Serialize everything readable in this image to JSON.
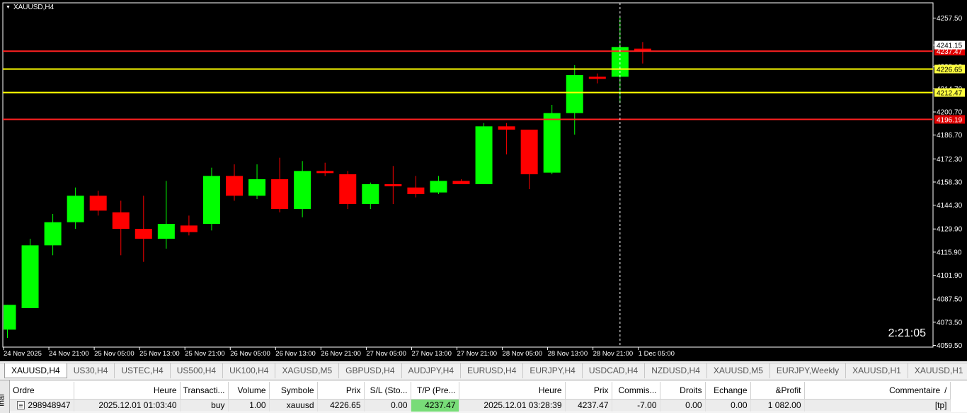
{
  "chart": {
    "symbol_label": "XAUUSD,H4",
    "timer": "2:21:05",
    "crosshair_time": "28 Nov 21:00",
    "x_labels": [
      "24 Nov 2025",
      "24 Nov 21:00",
      "25 Nov 05:00",
      "25 Nov 13:00",
      "25 Nov 21:00",
      "26 Nov 05:00",
      "26 Nov 13:00",
      "26 Nov 21:00",
      "27 Nov 05:00",
      "27 Nov 13:00",
      "27 Nov 21:00",
      "28 Nov 05:00",
      "28 Nov 13:00",
      "28 Nov 21:00",
      "1 Dec 05:00"
    ],
    "y_ticks": [
      "4257.50",
      "4241.15",
      "4228.10",
      "4214.70",
      "4200.70",
      "4186.70",
      "4172.30",
      "4158.30",
      "4144.30",
      "4129.90",
      "4115.90",
      "4101.90",
      "4087.50",
      "4073.50",
      "4059.50"
    ],
    "price_tags": [
      {
        "text": "4237.47",
        "color": "#e00000",
        "text_color": "#ffffff"
      },
      {
        "text": "4226.65",
        "color": "#ffff40",
        "text_color": "#000000"
      },
      {
        "text": "4212.47",
        "color": "#ffff40",
        "text_color": "#000000"
      },
      {
        "text": "4196.19",
        "color": "#e00000",
        "text_color": "#ffffff"
      },
      {
        "text": "4241.15",
        "color": "#ffffff",
        "text_color": "#000000"
      }
    ],
    "colors": {
      "background": "#000000",
      "bull": "#00ff00",
      "bear": "#ff0000",
      "axis_text": "#ffffff",
      "sl_line": "#ff2020",
      "entry_line": "#ffff00"
    }
  },
  "chart_data": {
    "type": "candlestick",
    "symbol": "XAUUSD",
    "timeframe": "H4",
    "ylim": [
      4059.5,
      4264
    ],
    "horizontal_lines": [
      4237.47,
      4226.65,
      4212.47,
      4196.19
    ],
    "candles": [
      {
        "o": 4069,
        "h": 4084,
        "l": 4064,
        "c": 4084
      },
      {
        "o": 4082,
        "h": 4124,
        "l": 4082,
        "c": 4120
      },
      {
        "o": 4120,
        "h": 4139,
        "l": 4114,
        "c": 4134
      },
      {
        "o": 4134,
        "h": 4155,
        "l": 4130,
        "c": 4150
      },
      {
        "o": 4150,
        "h": 4153,
        "l": 4138,
        "c": 4141
      },
      {
        "o": 4140,
        "h": 4147,
        "l": 4114,
        "c": 4130
      },
      {
        "o": 4130,
        "h": 4150,
        "l": 4110,
        "c": 4124
      },
      {
        "o": 4124,
        "h": 4159,
        "l": 4118,
        "c": 4133
      },
      {
        "o": 4132,
        "h": 4138,
        "l": 4126,
        "c": 4128
      },
      {
        "o": 4133,
        "h": 4167,
        "l": 4129,
        "c": 4162
      },
      {
        "o": 4162,
        "h": 4169,
        "l": 4147,
        "c": 4150
      },
      {
        "o": 4150,
        "h": 4169,
        "l": 4148,
        "c": 4160
      },
      {
        "o": 4160,
        "h": 4173,
        "l": 4140,
        "c": 4142
      },
      {
        "o": 4142,
        "h": 4171,
        "l": 4137,
        "c": 4165
      },
      {
        "o": 4165,
        "h": 4170,
        "l": 4162,
        "c": 4164
      },
      {
        "o": 4163,
        "h": 4165,
        "l": 4142,
        "c": 4145
      },
      {
        "o": 4145,
        "h": 4158,
        "l": 4142,
        "c": 4157
      },
      {
        "o": 4157,
        "h": 4168,
        "l": 4145,
        "c": 4156
      },
      {
        "o": 4155,
        "h": 4162,
        "l": 4149,
        "c": 4151
      },
      {
        "o": 4152,
        "h": 4162,
        "l": 4151,
        "c": 4159
      },
      {
        "o": 4159,
        "h": 4160,
        "l": 4157,
        "c": 4157
      },
      {
        "o": 4157,
        "h": 4194,
        "l": 4157,
        "c": 4192
      },
      {
        "o": 4192,
        "h": 4194,
        "l": 4175,
        "c": 4190
      },
      {
        "o": 4190,
        "h": 4190,
        "l": 4154,
        "c": 4163
      },
      {
        "o": 4164,
        "h": 4205,
        "l": 4163,
        "c": 4200
      },
      {
        "o": 4200,
        "h": 4229,
        "l": 4187,
        "c": 4223
      },
      {
        "o": 4222,
        "h": 4224,
        "l": 4218,
        "c": 4221
      },
      {
        "o": 4222,
        "h": 4258,
        "l": 4206,
        "c": 4240
      },
      {
        "o": 4239,
        "h": 4243,
        "l": 4230,
        "c": 4238
      }
    ]
  },
  "tabs": [
    "XAUUSD,H4",
    "US30,H4",
    "USTEC,H4",
    "US500,H4",
    "UK100,H4",
    "XAGUSD,M5",
    "GBPUSD,H4",
    "AUDJPY,H4",
    "EURUSD,H4",
    "EURJPY,H4",
    "USDCAD,H4",
    "NZDUSD,H4",
    "XAUUSD,M5",
    "EURJPY,Weekly",
    "XAUUSD,H1",
    "XAUUSD,H1"
  ],
  "terminal": {
    "side_label": "inal",
    "headers": [
      "Ordre",
      "Heure",
      "Transacti...",
      "Volume",
      "Symbole",
      "Prix",
      "S/L (Sto...",
      "T/P (Pre...",
      "Heure",
      "Prix",
      "Commis...",
      "Droits",
      "Echange",
      "&Profit",
      "Commentaire"
    ],
    "row": [
      "298948947",
      "2025.12.01 01:03:40",
      "buy",
      "1.00",
      "xauusd",
      "4226.65",
      "0.00",
      "4237.47",
      "2025.12.01 03:28:39",
      "4237.47",
      "-7.00",
      "0.00",
      "0.00",
      "1 082.00",
      "[tp]"
    ],
    "close_glyph": "/",
    "tp_color": "#78dc78"
  }
}
